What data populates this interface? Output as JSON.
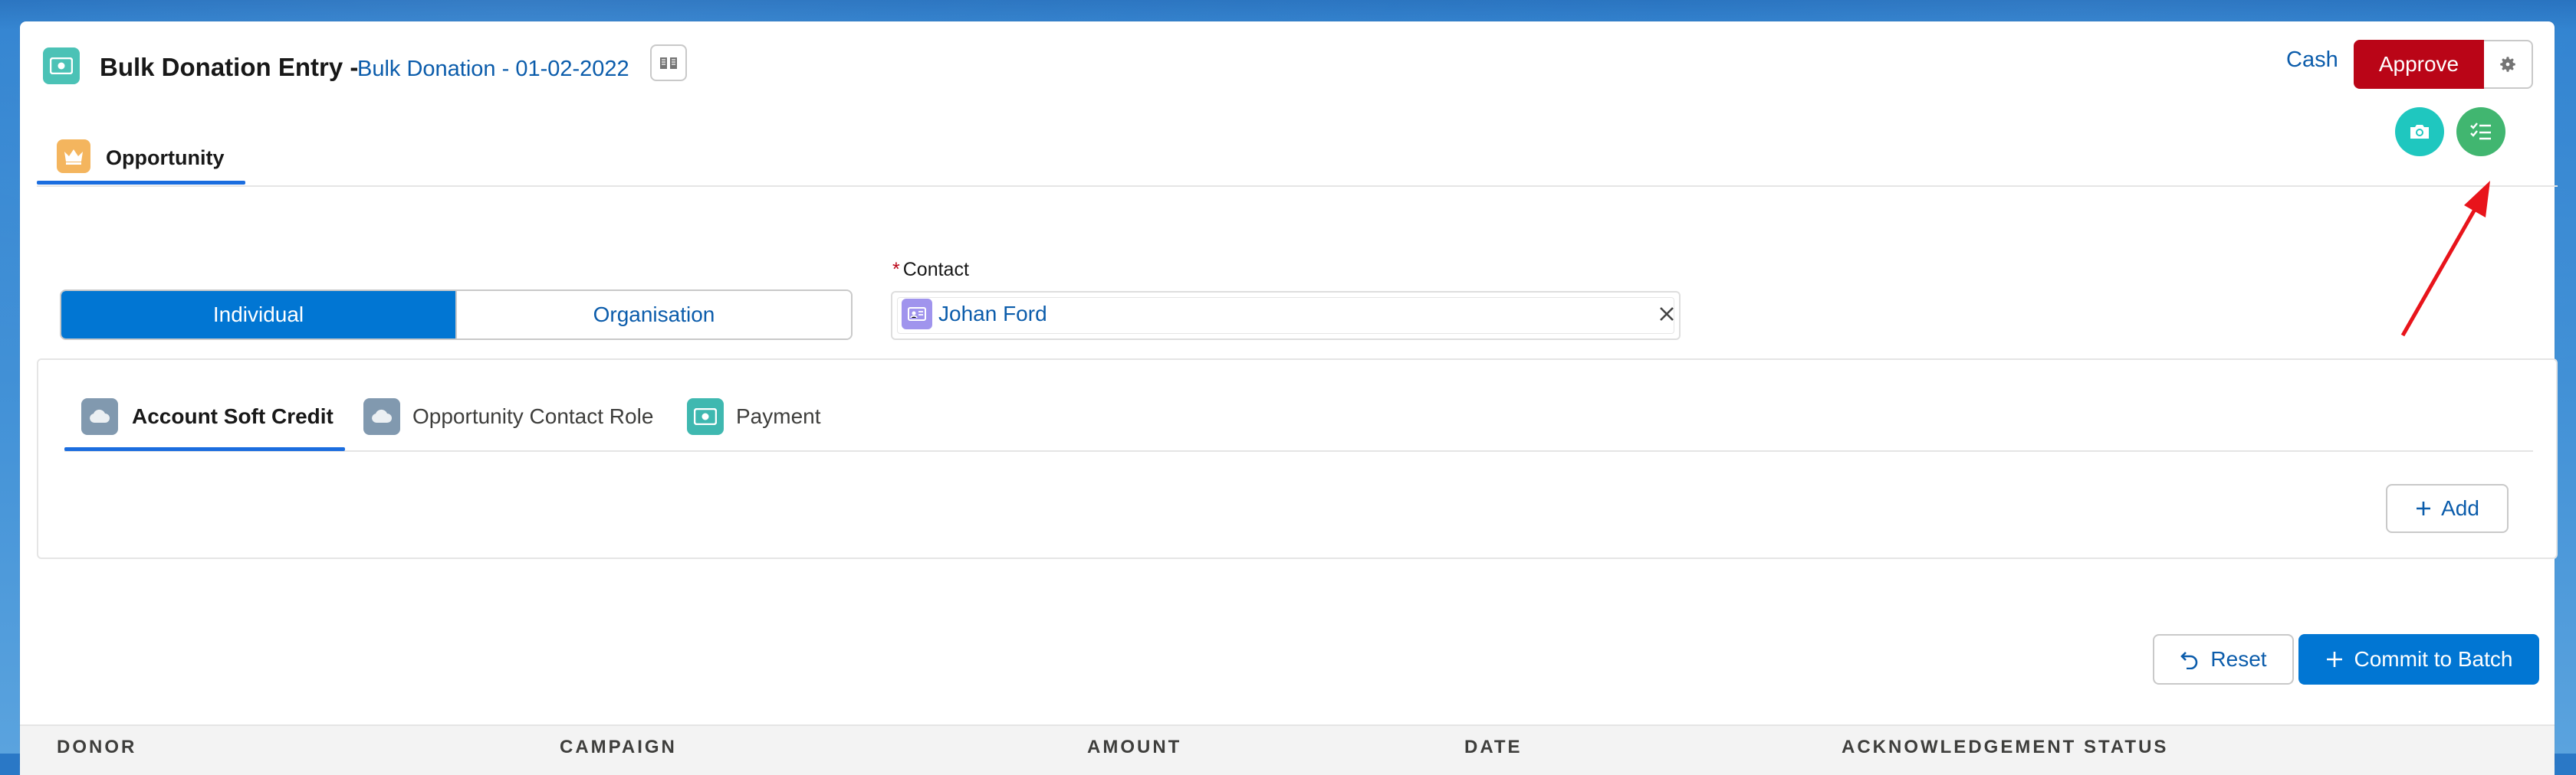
{
  "header": {
    "title": "Bulk Donation Entry -",
    "batch_link": "Bulk Donation - 01-02-2022",
    "cash_label": "Cash",
    "approve_label": "Approve"
  },
  "tabs": {
    "main_tab_label": "Opportunity"
  },
  "donor_type": {
    "options": [
      "Individual",
      "Organisation"
    ],
    "selected": "Individual"
  },
  "contact": {
    "label": "Contact",
    "required_marker": "*",
    "value": "Johan Ford"
  },
  "related_tabs": [
    {
      "label": "Account Soft Credit",
      "icon": "cloud-icon",
      "active": true
    },
    {
      "label": "Opportunity Contact Role",
      "icon": "cloud-icon",
      "active": false
    },
    {
      "label": "Payment",
      "icon": "money-icon",
      "active": false
    }
  ],
  "buttons": {
    "add": "Add",
    "reset": "Reset",
    "commit": "Commit to Batch"
  },
  "table": {
    "columns": [
      "DONOR",
      "CAMPAIGN",
      "AMOUNT",
      "DATE",
      "ACKNOWLEDGEMENT STATUS"
    ]
  },
  "colors": {
    "brand_blue": "#0176d3",
    "approve_red": "#ba0517",
    "annotation_red": "#e8141b"
  }
}
